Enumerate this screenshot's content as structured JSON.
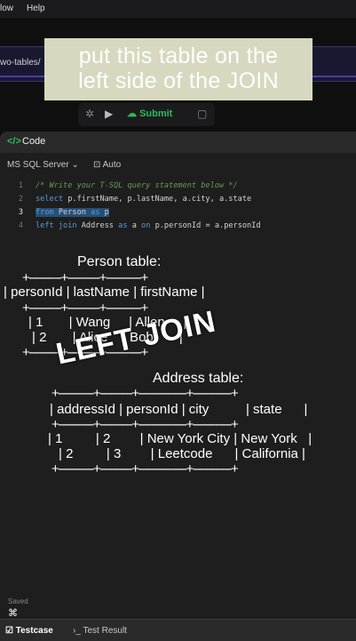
{
  "menubar": {
    "item_1": "low",
    "item_2": "Help"
  },
  "browser": {
    "url_fragment": "wo-tables/"
  },
  "caption": {
    "line1": "put this table on the",
    "line2": "left side of the JOIN"
  },
  "toolbar": {
    "submit_label": "Submit"
  },
  "panel": {
    "title": "Code",
    "language": "MS SQL Server",
    "auto": "Auto"
  },
  "editor": {
    "line_numbers": [
      "1",
      "2",
      "3",
      "4"
    ],
    "line1": "/* Write your T-SQL query statement below */",
    "line2_kw": "select",
    "line2_rest": " p.firstName, p.lastName, a.city, a.state",
    "line3_kw1": "from",
    "line3_mid": " Person ",
    "line3_kw2": "as",
    "line3_end": " p",
    "line4_kw1": "left join",
    "line4_mid": " Address ",
    "line4_kw2": "as",
    "line4_mid2": " a ",
    "line4_kw3": "on",
    "line4_end": " p.personId = a.personId"
  },
  "overlay": {
    "person_title": "Person table:",
    "person_border1": "+----------+----------+-----------+",
    "person_header": "| personId | lastName | firstName |",
    "person_border2": "+----------+----------+-----------+",
    "person_row1": "| 1       | Wang     | Allen     |",
    "person_row2": "| 2       | Alice    | Bob       |",
    "person_border3": "+----------+----------+-----------+",
    "left_join": "LEFT JOIN",
    "address_title": "Address table:",
    "address_border1": "+-----------+----------+---------------+------------+",
    "address_header": "| addressId | personId | city          | state      |",
    "address_border2": "+-----------+----------+---------------+------------+",
    "address_row1": "| 1         | 2        | New York City | New York   |",
    "address_row2": "| 2         | 3        | Leetcode      | California |",
    "address_border3": "+-----------+----------+---------------+------------+"
  },
  "footer": {
    "saved": "Saved",
    "testcase": "Testcase",
    "test_result": "Test Result"
  },
  "colors": {
    "submit": "#2cbb5d",
    "caption_bg": "#d8d8c0",
    "selection": "#264f78"
  }
}
